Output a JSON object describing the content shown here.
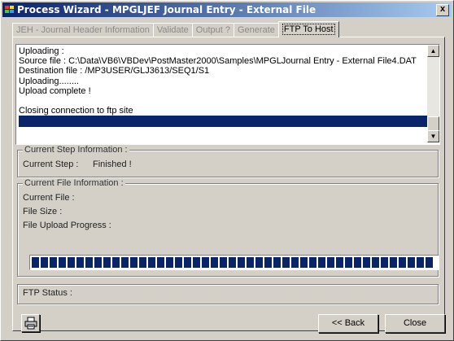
{
  "window": {
    "title": "Process Wizard - MPGLJEF Journal Entry - External File",
    "close_glyph": "x",
    "accent_color": "#0a246a"
  },
  "tabs": [
    {
      "label": "JEH - Journal Header Information",
      "active": false
    },
    {
      "label": "Validate",
      "active": false
    },
    {
      "label": "Output ?",
      "active": false
    },
    {
      "label": "Generate",
      "active": false
    },
    {
      "label": "FTP To Host",
      "active": true
    }
  ],
  "log": {
    "lines": [
      "Uploading :",
      "Source file    : C:\\Data\\VB6\\VBDev\\PostMaster2000\\Samples\\MPGLJournal Entry - External File4.DAT",
      "Destination file : /MP3USER/GLJ3613/SEQ1/S1",
      "Uploading........",
      "Upload complete !",
      "",
      "Closing connection to ftp site",
      ""
    ],
    "selected_index": 7
  },
  "step_info": {
    "group_title": "Current Step Information :",
    "label": "Current Step :",
    "value": "Finished !"
  },
  "file_info": {
    "group_title": "Current File Information :",
    "current_file_label": "Current File :",
    "file_size_label": "File Size :",
    "progress_label": "File Upload Progress :",
    "progress_fraction": 1.0
  },
  "ftp_status": {
    "label": "FTP Status :"
  },
  "buttons": {
    "print_icon": "printer-icon",
    "back": "<< Back",
    "close": "Close"
  }
}
